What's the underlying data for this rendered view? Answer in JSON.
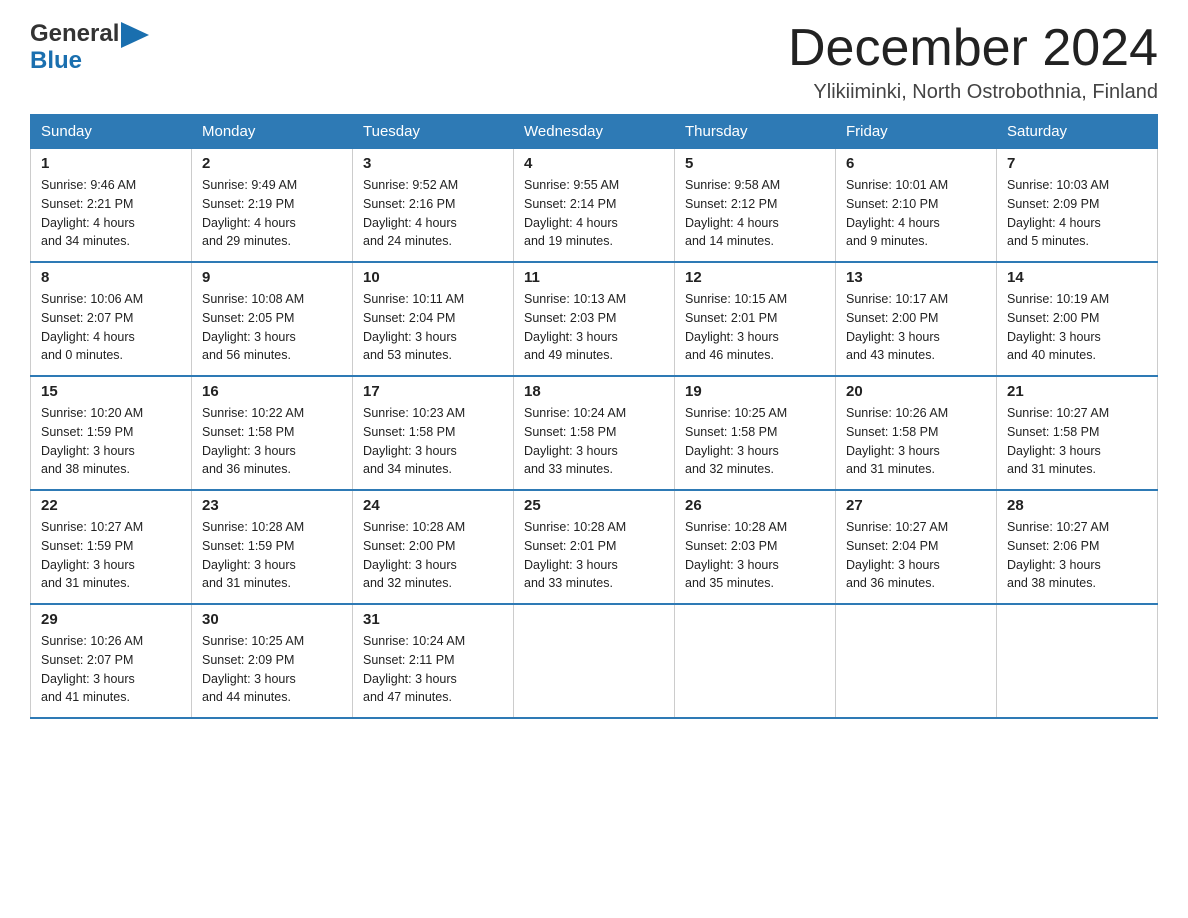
{
  "header": {
    "logo_line1": "General",
    "logo_line2": "Blue",
    "title": "December 2024",
    "location": "Ylikiiminki, North Ostrobothnia, Finland"
  },
  "weekdays": [
    "Sunday",
    "Monday",
    "Tuesday",
    "Wednesday",
    "Thursday",
    "Friday",
    "Saturday"
  ],
  "weeks": [
    [
      {
        "day": "1",
        "sunrise": "Sunrise: 9:46 AM",
        "sunset": "Sunset: 2:21 PM",
        "daylight": "Daylight: 4 hours",
        "daylight2": "and 34 minutes."
      },
      {
        "day": "2",
        "sunrise": "Sunrise: 9:49 AM",
        "sunset": "Sunset: 2:19 PM",
        "daylight": "Daylight: 4 hours",
        "daylight2": "and 29 minutes."
      },
      {
        "day": "3",
        "sunrise": "Sunrise: 9:52 AM",
        "sunset": "Sunset: 2:16 PM",
        "daylight": "Daylight: 4 hours",
        "daylight2": "and 24 minutes."
      },
      {
        "day": "4",
        "sunrise": "Sunrise: 9:55 AM",
        "sunset": "Sunset: 2:14 PM",
        "daylight": "Daylight: 4 hours",
        "daylight2": "and 19 minutes."
      },
      {
        "day": "5",
        "sunrise": "Sunrise: 9:58 AM",
        "sunset": "Sunset: 2:12 PM",
        "daylight": "Daylight: 4 hours",
        "daylight2": "and 14 minutes."
      },
      {
        "day": "6",
        "sunrise": "Sunrise: 10:01 AM",
        "sunset": "Sunset: 2:10 PM",
        "daylight": "Daylight: 4 hours",
        "daylight2": "and 9 minutes."
      },
      {
        "day": "7",
        "sunrise": "Sunrise: 10:03 AM",
        "sunset": "Sunset: 2:09 PM",
        "daylight": "Daylight: 4 hours",
        "daylight2": "and 5 minutes."
      }
    ],
    [
      {
        "day": "8",
        "sunrise": "Sunrise: 10:06 AM",
        "sunset": "Sunset: 2:07 PM",
        "daylight": "Daylight: 4 hours",
        "daylight2": "and 0 minutes."
      },
      {
        "day": "9",
        "sunrise": "Sunrise: 10:08 AM",
        "sunset": "Sunset: 2:05 PM",
        "daylight": "Daylight: 3 hours",
        "daylight2": "and 56 minutes."
      },
      {
        "day": "10",
        "sunrise": "Sunrise: 10:11 AM",
        "sunset": "Sunset: 2:04 PM",
        "daylight": "Daylight: 3 hours",
        "daylight2": "and 53 minutes."
      },
      {
        "day": "11",
        "sunrise": "Sunrise: 10:13 AM",
        "sunset": "Sunset: 2:03 PM",
        "daylight": "Daylight: 3 hours",
        "daylight2": "and 49 minutes."
      },
      {
        "day": "12",
        "sunrise": "Sunrise: 10:15 AM",
        "sunset": "Sunset: 2:01 PM",
        "daylight": "Daylight: 3 hours",
        "daylight2": "and 46 minutes."
      },
      {
        "day": "13",
        "sunrise": "Sunrise: 10:17 AM",
        "sunset": "Sunset: 2:00 PM",
        "daylight": "Daylight: 3 hours",
        "daylight2": "and 43 minutes."
      },
      {
        "day": "14",
        "sunrise": "Sunrise: 10:19 AM",
        "sunset": "Sunset: 2:00 PM",
        "daylight": "Daylight: 3 hours",
        "daylight2": "and 40 minutes."
      }
    ],
    [
      {
        "day": "15",
        "sunrise": "Sunrise: 10:20 AM",
        "sunset": "Sunset: 1:59 PM",
        "daylight": "Daylight: 3 hours",
        "daylight2": "and 38 minutes."
      },
      {
        "day": "16",
        "sunrise": "Sunrise: 10:22 AM",
        "sunset": "Sunset: 1:58 PM",
        "daylight": "Daylight: 3 hours",
        "daylight2": "and 36 minutes."
      },
      {
        "day": "17",
        "sunrise": "Sunrise: 10:23 AM",
        "sunset": "Sunset: 1:58 PM",
        "daylight": "Daylight: 3 hours",
        "daylight2": "and 34 minutes."
      },
      {
        "day": "18",
        "sunrise": "Sunrise: 10:24 AM",
        "sunset": "Sunset: 1:58 PM",
        "daylight": "Daylight: 3 hours",
        "daylight2": "and 33 minutes."
      },
      {
        "day": "19",
        "sunrise": "Sunrise: 10:25 AM",
        "sunset": "Sunset: 1:58 PM",
        "daylight": "Daylight: 3 hours",
        "daylight2": "and 32 minutes."
      },
      {
        "day": "20",
        "sunrise": "Sunrise: 10:26 AM",
        "sunset": "Sunset: 1:58 PM",
        "daylight": "Daylight: 3 hours",
        "daylight2": "and 31 minutes."
      },
      {
        "day": "21",
        "sunrise": "Sunrise: 10:27 AM",
        "sunset": "Sunset: 1:58 PM",
        "daylight": "Daylight: 3 hours",
        "daylight2": "and 31 minutes."
      }
    ],
    [
      {
        "day": "22",
        "sunrise": "Sunrise: 10:27 AM",
        "sunset": "Sunset: 1:59 PM",
        "daylight": "Daylight: 3 hours",
        "daylight2": "and 31 minutes."
      },
      {
        "day": "23",
        "sunrise": "Sunrise: 10:28 AM",
        "sunset": "Sunset: 1:59 PM",
        "daylight": "Daylight: 3 hours",
        "daylight2": "and 31 minutes."
      },
      {
        "day": "24",
        "sunrise": "Sunrise: 10:28 AM",
        "sunset": "Sunset: 2:00 PM",
        "daylight": "Daylight: 3 hours",
        "daylight2": "and 32 minutes."
      },
      {
        "day": "25",
        "sunrise": "Sunrise: 10:28 AM",
        "sunset": "Sunset: 2:01 PM",
        "daylight": "Daylight: 3 hours",
        "daylight2": "and 33 minutes."
      },
      {
        "day": "26",
        "sunrise": "Sunrise: 10:28 AM",
        "sunset": "Sunset: 2:03 PM",
        "daylight": "Daylight: 3 hours",
        "daylight2": "and 35 minutes."
      },
      {
        "day": "27",
        "sunrise": "Sunrise: 10:27 AM",
        "sunset": "Sunset: 2:04 PM",
        "daylight": "Daylight: 3 hours",
        "daylight2": "and 36 minutes."
      },
      {
        "day": "28",
        "sunrise": "Sunrise: 10:27 AM",
        "sunset": "Sunset: 2:06 PM",
        "daylight": "Daylight: 3 hours",
        "daylight2": "and 38 minutes."
      }
    ],
    [
      {
        "day": "29",
        "sunrise": "Sunrise: 10:26 AM",
        "sunset": "Sunset: 2:07 PM",
        "daylight": "Daylight: 3 hours",
        "daylight2": "and 41 minutes."
      },
      {
        "day": "30",
        "sunrise": "Sunrise: 10:25 AM",
        "sunset": "Sunset: 2:09 PM",
        "daylight": "Daylight: 3 hours",
        "daylight2": "and 44 minutes."
      },
      {
        "day": "31",
        "sunrise": "Sunrise: 10:24 AM",
        "sunset": "Sunset: 2:11 PM",
        "daylight": "Daylight: 3 hours",
        "daylight2": "and 47 minutes."
      },
      null,
      null,
      null,
      null
    ]
  ]
}
